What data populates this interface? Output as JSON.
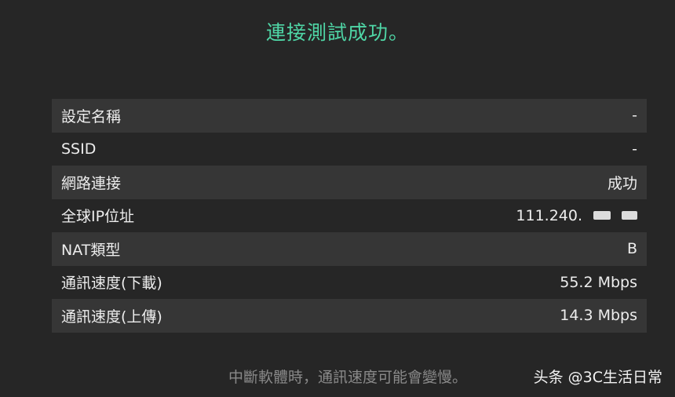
{
  "title": "連接測試成功。",
  "rows": [
    {
      "label": "設定名稱",
      "value": "-"
    },
    {
      "label": "SSID",
      "value": "-"
    },
    {
      "label": "網路連接",
      "value": "成功"
    },
    {
      "label": "全球IP位址",
      "value": "111.240."
    },
    {
      "label": "NAT類型",
      "value": "B"
    },
    {
      "label": "通訊速度(下載)",
      "value": "55.2 Mbps"
    },
    {
      "label": "通訊速度(上傳)",
      "value": "14.3 Mbps"
    }
  ],
  "note": "中斷軟體時，通訊速度可能會變慢。",
  "watermark": "头条 @3C生活日常",
  "colors": {
    "background": "#262626",
    "row_shade": "#363636",
    "title": "#4fd6a6",
    "note": "#8a8a8a"
  }
}
